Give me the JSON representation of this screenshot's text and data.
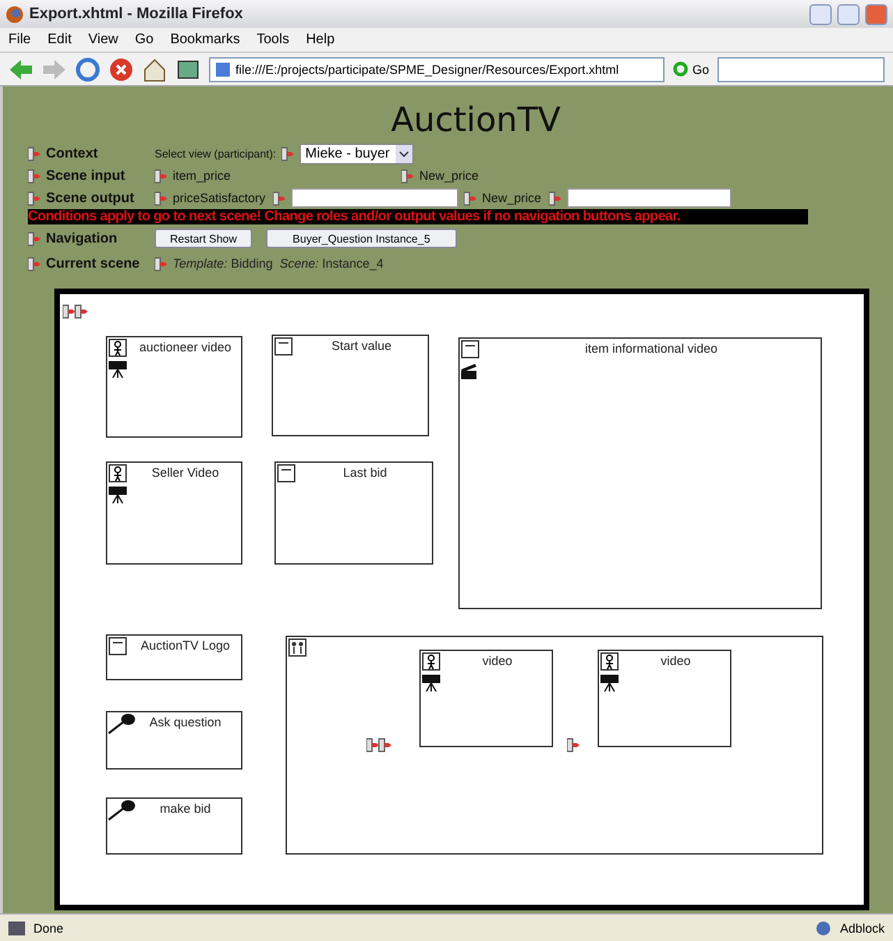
{
  "window": {
    "title": "Export.xhtml - Mozilla Firefox"
  },
  "menu": [
    "File",
    "Edit",
    "View",
    "Go",
    "Bookmarks",
    "Tools",
    "Help"
  ],
  "toolbar": {
    "address": "file:///E:/projects/participate/SPME_Designer/Resources/Export.xhtml",
    "go": "Go"
  },
  "page": {
    "title": "AuctionTV",
    "context": {
      "label": "Context",
      "prompt": "Select view (participant):",
      "value": "Mieke - buyer"
    },
    "scene_input": {
      "label": "Scene input",
      "fields": [
        "item_price",
        "New_price"
      ]
    },
    "scene_output": {
      "label": "Scene output",
      "fields": [
        "priceSatisfactory",
        "New_price"
      ]
    },
    "warning": "Conditions apply to go to next scene! Change roles and/or output values if no navigation buttons appear.",
    "navigation": {
      "label": "Navigation",
      "buttons": [
        "Restart Show",
        "Buyer_Question Instance_5"
      ]
    },
    "current_scene": {
      "label": "Current scene",
      "text": "*Template:* Bidding  *Scene:* Instance_4"
    }
  },
  "canvas": {
    "boxes": [
      {
        "kind": "video",
        "title": "auctioneer video"
      },
      {
        "kind": "text",
        "title": "Start value"
      },
      {
        "kind": "clip",
        "title": "item informational video"
      },
      {
        "kind": "video",
        "title": "Seller Video"
      },
      {
        "kind": "text",
        "title": "Last bid"
      },
      {
        "kind": "text",
        "title": "AuctionTV Logo"
      },
      {
        "kind": "action",
        "title": "Ask question"
      },
      {
        "kind": "action",
        "title": "make bid"
      },
      {
        "kind": "container",
        "children": [
          {
            "kind": "video",
            "title": "video"
          },
          {
            "kind": "video",
            "title": "video"
          }
        ]
      }
    ]
  },
  "status_bar": {
    "text": "Done",
    "addon": "Adblock"
  }
}
